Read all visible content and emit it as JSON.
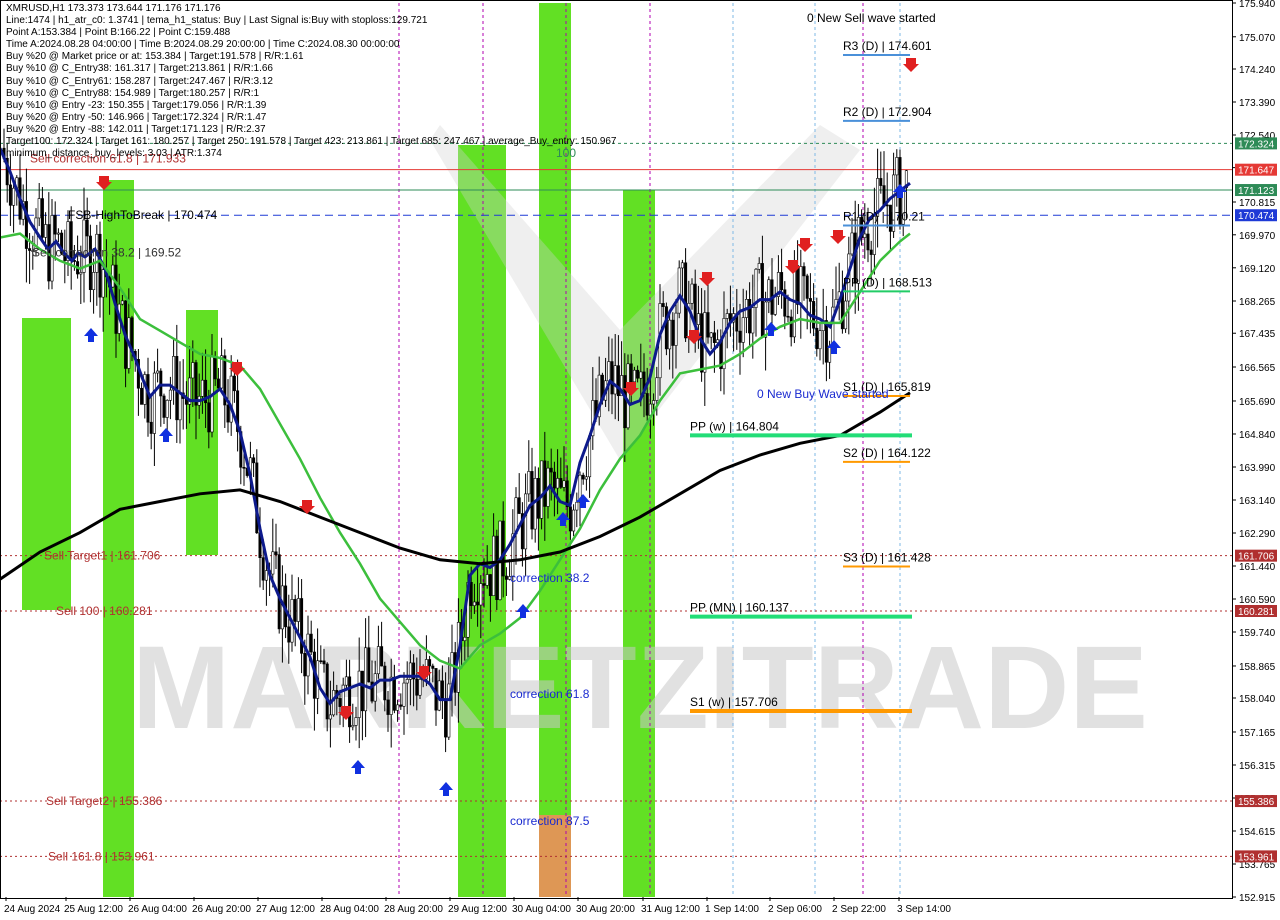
{
  "symbol_header": "XMRUSD,H1  173.373 173.644 171.176 171.176",
  "info_lines": [
    "Line:1474  |  h1_atr_c0: 1.3741  |  tema_h1_status: Buy  |  Last Signal is:Buy with stoploss:129.721",
    "Point A:153.384  |  Point B:166.22  |  Point C:159.488",
    "Time A:2024.08.28 04:00:00  |  Time B:2024.08.29 20:00:00  |  Time C:2024.08.30 00:00:00",
    "Buy %20 @ Market price or at: 153.384  |  Target:191.578  |  R/R:1.61",
    "Buy %10 @ C_Entry38: 161.317  |  Target:213.861  |  R/R:1.66",
    "Buy %10 @ C_Entry61: 158.287  |  Target:247.467  |  R/R:3.12",
    "Buy %10 @ C_Entry88: 154.989  |  Target:180.257  |  R/R:1",
    "Buy %10 @ Entry -23: 150.355  |  Target:179.056  |  R/R:1.39",
    "Buy %20 @ Entry -50: 146.966  |  Target:172.324  |  R/R:1.47",
    "Buy %20 @ Entry -88: 142.011  |  Target:171.123  |  R/R:2.37",
    "Target100: 172.324  |  Target 161: 180.257  |  Target 250: 191.578  |  Target 423: 213.861  |  Target 685: 247.467  |  average_Buy_entry: 150.967",
    "minimum_distance_buy_levels: 3.03  |  ATR:1.374"
  ],
  "chart_data": {
    "type": "candlestick",
    "symbol": "XMRUSD",
    "timeframe": "H1",
    "ohlc_last": {
      "open": 173.373,
      "high": 173.644,
      "low": 171.176,
      "close": 171.176
    },
    "ylim": [
      152.915,
      175.94
    ],
    "y_ticks": [
      "175.940",
      "175.070",
      "174.240",
      "173.390",
      "172.540",
      "171.700",
      "170.815",
      "169.970",
      "169.120",
      "168.265",
      "167.435",
      "166.565",
      "165.690",
      "164.840",
      "163.990",
      "163.140",
      "162.290",
      "161.440",
      "160.590",
      "159.740",
      "158.865",
      "158.040",
      "157.165",
      "156.315",
      "155.465",
      "154.615",
      "153.765",
      "152.915"
    ],
    "x_labels": [
      "24 Aug 2024",
      "25 Aug 12:00",
      "26 Aug 04:00",
      "26 Aug 20:00",
      "27 Aug 12:00",
      "28 Aug 04:00",
      "28 Aug 20:00",
      "29 Aug 12:00",
      "30 Aug 04:00",
      "30 Aug 20:00",
      "31 Aug 12:00",
      "1 Sep 14:00",
      "2 Sep 06:00",
      "2 Sep 22:00",
      "3 Sep 14:00"
    ],
    "price_tags": [
      {
        "value": 172.324,
        "text": "172.324",
        "color": "#2e8b57"
      },
      {
        "value": 171.647,
        "text": "171.647",
        "color": "#e53935"
      },
      {
        "value": 171.123,
        "text": "171.123",
        "color": "#2e8b57"
      },
      {
        "value": 170.474,
        "text": "170.474",
        "color": "#1e3ad6"
      },
      {
        "value": 161.706,
        "text": "161.706",
        "color": "#b03030"
      },
      {
        "value": 160.281,
        "text": "160.281",
        "color": "#b03030"
      },
      {
        "value": 155.386,
        "text": "155.386",
        "color": "#b03030"
      },
      {
        "value": 153.961,
        "text": "153.961",
        "color": "#b03030"
      }
    ],
    "pivot_levels": [
      {
        "label": "R3 (D) | 174.601",
        "value": 174.601,
        "color": "#4a90d9"
      },
      {
        "label": "R2 (D) | 172.904",
        "value": 172.904,
        "color": "#4a90d9"
      },
      {
        "label": "R1 (D) | 170.21",
        "value": 170.21,
        "color": "#4a90d9"
      },
      {
        "label": "PP (D) | 168.513",
        "value": 168.513,
        "color": "#22cc66"
      },
      {
        "label": "S1 (D) | 165.819",
        "value": 165.819,
        "color": "#ff9900"
      },
      {
        "label": "S2 (D) | 164.122",
        "value": 164.122,
        "color": "#ff9900"
      },
      {
        "label": "S3 (D) | 161.428",
        "value": 161.428,
        "color": "#ff9900"
      },
      {
        "label": "PP (w) | 164.804",
        "value": 164.804,
        "color": "#22dd77"
      },
      {
        "label": "PP (MN) | 160.137",
        "value": 160.137,
        "color": "#22dd77"
      },
      {
        "label": "S1 (w) | 157.706",
        "value": 157.706,
        "color": "#ff9900"
      }
    ],
    "left_labels": [
      {
        "text": "Sell correction 61.8 | 171.933",
        "value": 171.933,
        "color": "#b03030"
      },
      {
        "text": "FSB-HighToBreak | 170.474",
        "value": 170.474,
        "color": "#000000"
      },
      {
        "text": "Sell correction 38.2 | 169.52",
        "value": 169.52,
        "color": "#333333"
      },
      {
        "text": "Sell Target1 | 161.706",
        "value": 161.706,
        "color": "#b03030"
      },
      {
        "text": "Sell 100 | 160.281",
        "value": 160.281,
        "color": "#b03030"
      },
      {
        "text": "Sell Target2 | 155.386",
        "value": 155.386,
        "color": "#b03030"
      },
      {
        "text": "Sell 161.8 | 153.961",
        "value": 153.961,
        "color": "#b03030"
      }
    ],
    "annotations": [
      {
        "text": "0 New Sell wave started",
        "color": "#000000"
      },
      {
        "text": "0 New Buy Wave started",
        "color": "#1a2ad0"
      },
      {
        "text": "correction 38.2",
        "color": "#1a2ad0"
      },
      {
        "text": "correction 61.8",
        "color": "#1a2ad0"
      },
      {
        "text": "correction 87.5",
        "color": "#1a2ad0"
      },
      {
        "text": "100",
        "color": "#2e8b57"
      }
    ],
    "watermark": "MARKETZITRADE",
    "series": [
      {
        "name": "blue_tema",
        "color": "#0d1a8c",
        "x": [
          0,
          10,
          20,
          30,
          40,
          48,
          56,
          64,
          72,
          78,
          85,
          95,
          105,
          115,
          125,
          135,
          142,
          150,
          160,
          170,
          180,
          190,
          200,
          210,
          220,
          230,
          240,
          250,
          260,
          270,
          280,
          290,
          300,
          310,
          320,
          330,
          340,
          350,
          360,
          370,
          380,
          390,
          400,
          410,
          420,
          430,
          440,
          450,
          460,
          470,
          480,
          490,
          500,
          510,
          520,
          530,
          540,
          550,
          560,
          570,
          580,
          590,
          600,
          610,
          620,
          630,
          640,
          650,
          660,
          670,
          680,
          690,
          700,
          710,
          720,
          730,
          740,
          750,
          760,
          770,
          780,
          790,
          800,
          810,
          820,
          830,
          840,
          850,
          860,
          870,
          880,
          890,
          900,
          910
        ],
        "y": [
          172.2,
          171.6,
          170.9,
          170.3,
          169.9,
          169.6,
          169.8,
          169.5,
          169.3,
          169.5,
          169.4,
          169.6,
          169.1,
          168.2,
          167.4,
          166.8,
          166.3,
          165.8,
          166.1,
          166.1,
          165.9,
          165.7,
          165.7,
          165.8,
          166.0,
          165.6,
          164.9,
          163.8,
          162.4,
          161.2,
          160.6,
          160.1,
          159.6,
          159.1,
          158.3,
          157.9,
          158.2,
          158.3,
          158.4,
          158.3,
          158.5,
          158.5,
          158.6,
          158.6,
          158.6,
          158.4,
          158.0,
          158.0,
          159.4,
          161.2,
          161.5,
          161.4,
          161.6,
          162.0,
          162.5,
          163.0,
          163.2,
          163.5,
          163.1,
          163.0,
          164.1,
          164.8,
          165.6,
          166.2,
          166.0,
          165.6,
          165.7,
          166.3,
          167.4,
          168.0,
          168.4,
          168.0,
          167.3,
          166.9,
          167.2,
          167.7,
          168.0,
          168.1,
          168.3,
          168.3,
          168.5,
          168.3,
          168.2,
          167.9,
          167.8,
          167.6,
          168.3,
          169.1,
          169.9,
          170.4,
          170.6,
          170.9,
          171.1,
          171.3
        ]
      },
      {
        "name": "green_ma",
        "color": "#3cbf3c",
        "x": [
          0,
          20,
          40,
          60,
          80,
          100,
          120,
          140,
          160,
          180,
          200,
          220,
          240,
          260,
          280,
          300,
          320,
          340,
          360,
          380,
          400,
          420,
          440,
          460,
          480,
          500,
          520,
          540,
          560,
          580,
          600,
          620,
          640,
          660,
          680,
          700,
          720,
          740,
          760,
          780,
          800,
          820,
          840,
          860,
          880,
          900,
          910
        ],
        "y": [
          169.9,
          170.0,
          169.6,
          169.3,
          169.1,
          169.3,
          168.6,
          167.8,
          167.5,
          167.2,
          166.9,
          166.8,
          166.6,
          166.0,
          165.1,
          164.2,
          163.2,
          162.3,
          161.5,
          160.6,
          160.0,
          159.4,
          159.0,
          158.8,
          159.4,
          159.7,
          160.1,
          160.8,
          161.6,
          162.4,
          163.4,
          164.2,
          164.8,
          165.7,
          166.4,
          166.5,
          166.6,
          166.9,
          167.3,
          167.6,
          167.8,
          167.7,
          167.7,
          168.5,
          169.3,
          169.8,
          170.0
        ]
      },
      {
        "name": "black_ma",
        "color": "#000000",
        "x": [
          0,
          40,
          80,
          120,
          160,
          200,
          240,
          280,
          320,
          360,
          400,
          440,
          480,
          520,
          560,
          600,
          640,
          680,
          720,
          760,
          800,
          840,
          880,
          910
        ],
        "y": [
          161.1,
          161.8,
          162.3,
          162.9,
          163.1,
          163.3,
          163.4,
          163.1,
          162.7,
          162.3,
          161.9,
          161.6,
          161.5,
          161.6,
          161.8,
          162.2,
          162.7,
          163.3,
          163.9,
          164.3,
          164.6,
          164.8,
          165.4,
          165.9
        ]
      }
    ]
  }
}
